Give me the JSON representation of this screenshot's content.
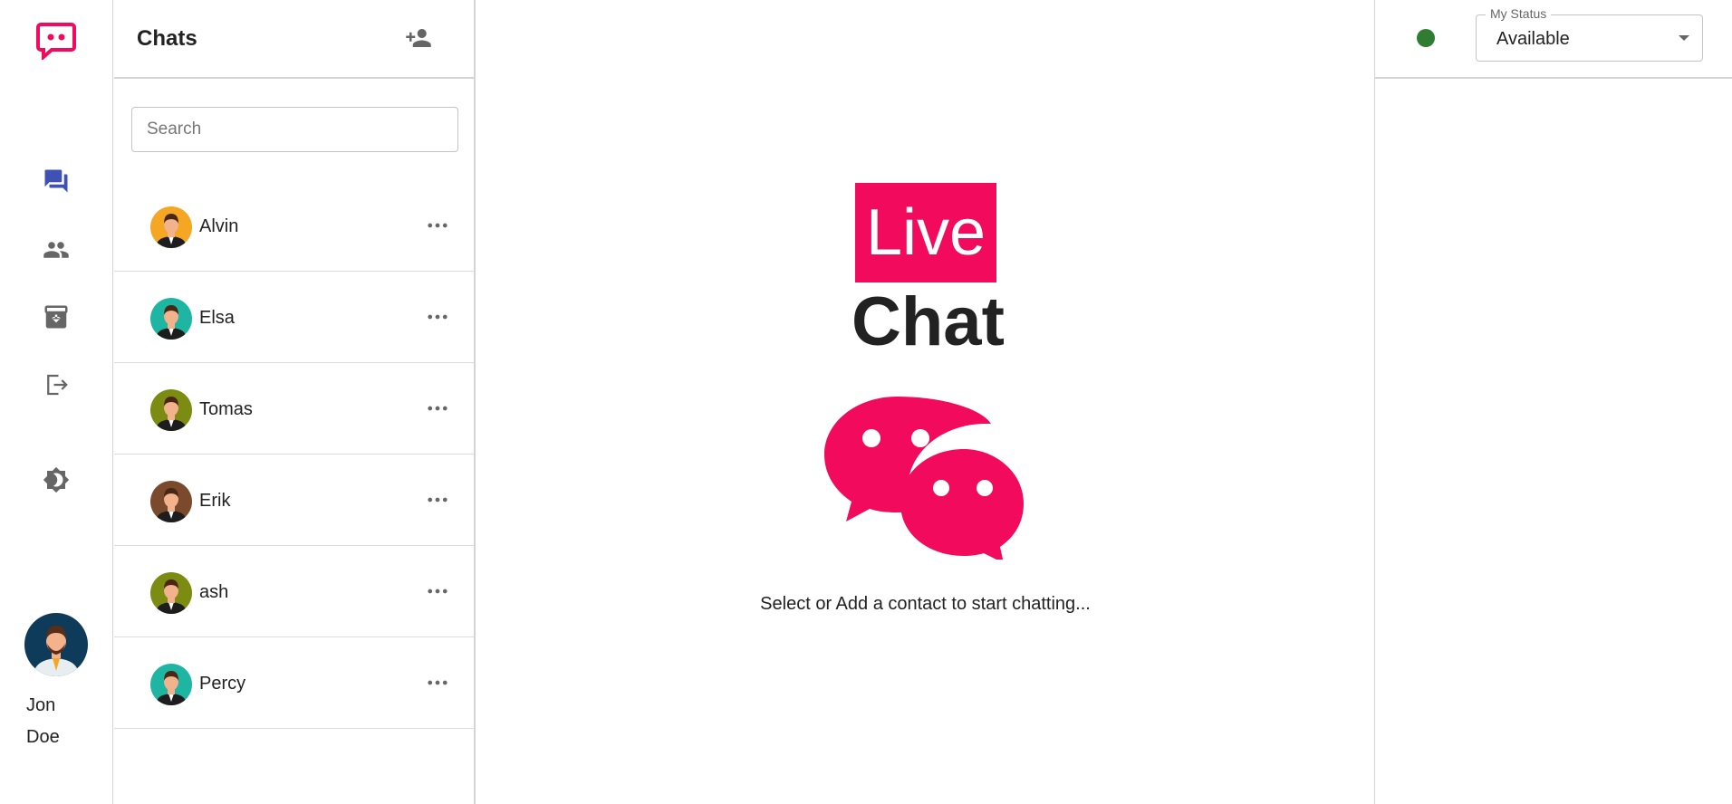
{
  "sidebar": {
    "logo_icon": "chat-dots-logo",
    "nav": [
      {
        "name": "chats-nav",
        "icon": "forum-icon",
        "active": true
      },
      {
        "name": "contacts-nav",
        "icon": "people-icon",
        "active": false
      },
      {
        "name": "archive-nav",
        "icon": "archive-icon",
        "active": false
      },
      {
        "name": "logout-nav",
        "icon": "logout-icon",
        "active": false
      },
      {
        "name": "theme-nav",
        "icon": "brightness-icon",
        "active": false
      }
    ],
    "user": {
      "first": "Jon",
      "last": "Doe"
    }
  },
  "chats": {
    "title": "Chats",
    "search_placeholder": "Search",
    "contacts": [
      {
        "name": "Alvin",
        "bg": "#f5a623"
      },
      {
        "name": "Elsa",
        "bg": "#1fb5a3"
      },
      {
        "name": "Tomas",
        "bg": "#7c8b12"
      },
      {
        "name": "Erik",
        "bg": "#7b4a2c"
      },
      {
        "name": "ash",
        "bg": "#7c8b12"
      },
      {
        "name": "Percy",
        "bg": "#1fb5a3"
      }
    ]
  },
  "main": {
    "brand_word1": "Live",
    "brand_word2": "Chat",
    "hint": "Select or Add a contact to start chatting..."
  },
  "status": {
    "label": "My Status",
    "value": "Available",
    "color": "#2e7d32"
  },
  "colors": {
    "accent": "#f20a5d",
    "nav_active": "#3f51b5",
    "icon_gray": "#666666"
  }
}
